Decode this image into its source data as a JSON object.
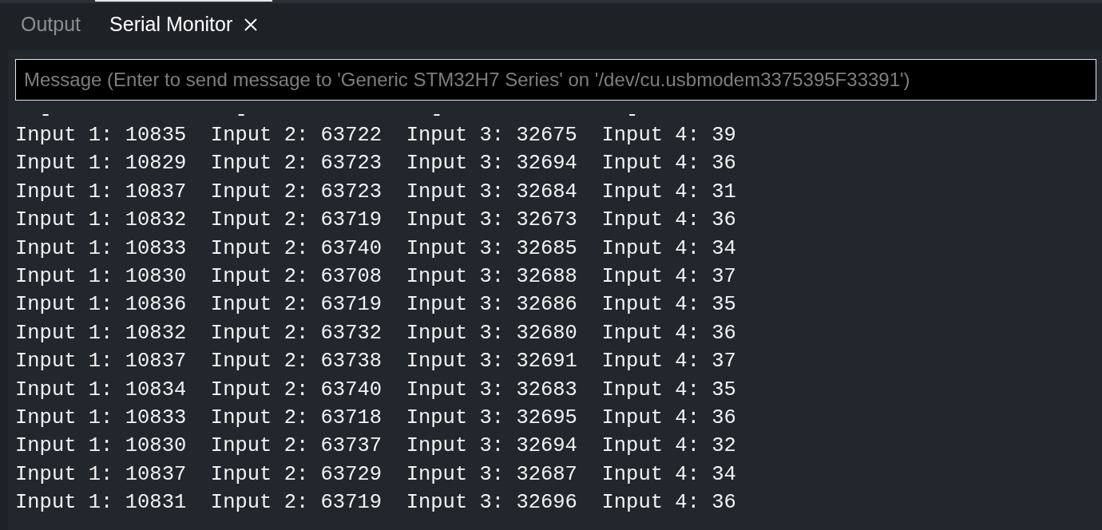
{
  "tabs": [
    {
      "label": "Output",
      "selected": false,
      "closable": false
    },
    {
      "label": "Serial Monitor",
      "selected": true,
      "closable": true
    }
  ],
  "message_field": {
    "placeholder": "Message (Enter to send message to 'Generic STM32H7 Series' on '/dev/cu.usbmodem3375395F33391')"
  },
  "cut_off_line": [
    "-",
    "-",
    "-",
    "-"
  ],
  "output_lines": [
    "Input 1: 10835  Input 2: 63722  Input 3: 32675  Input 4: 39",
    "Input 1: 10829  Input 2: 63723  Input 3: 32694  Input 4: 36",
    "Input 1: 10837  Input 2: 63723  Input 3: 32684  Input 4: 31",
    "Input 1: 10832  Input 2: 63719  Input 3: 32673  Input 4: 36",
    "Input 1: 10833  Input 2: 63740  Input 3: 32685  Input 4: 34",
    "Input 1: 10830  Input 2: 63708  Input 3: 32688  Input 4: 37",
    "Input 1: 10836  Input 2: 63719  Input 3: 32686  Input 4: 35",
    "Input 1: 10832  Input 2: 63732  Input 3: 32680  Input 4: 36",
    "Input 1: 10837  Input 2: 63738  Input 3: 32691  Input 4: 37",
    "Input 1: 10834  Input 2: 63740  Input 3: 32683  Input 4: 35",
    "Input 1: 10833  Input 2: 63718  Input 3: 32695  Input 4: 36",
    "Input 1: 10830  Input 2: 63737  Input 3: 32694  Input 4: 32",
    "Input 1: 10837  Input 2: 63729  Input 3: 32687  Input 4: 34",
    "Input 1: 10831  Input 2: 63719  Input 3: 32696  Input 4: 36"
  ]
}
